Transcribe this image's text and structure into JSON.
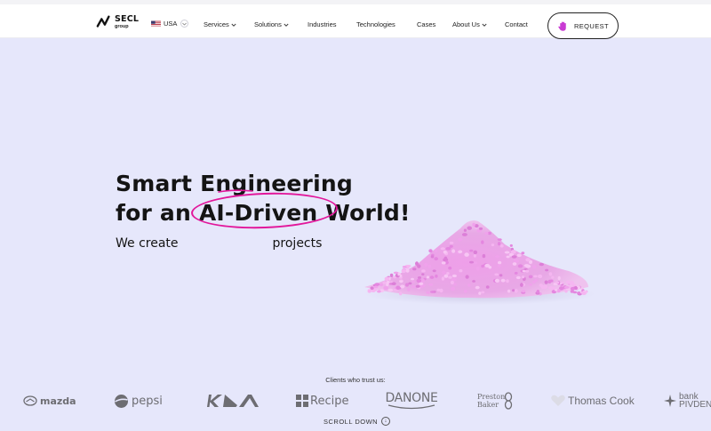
{
  "header": {
    "logo": {
      "name": "SECL",
      "sub": "group"
    },
    "language": {
      "code": "USA"
    },
    "nav": [
      {
        "label": "Services",
        "dropdown": true
      },
      {
        "label": "Solutions",
        "dropdown": true
      },
      {
        "label": "Industries",
        "dropdown": false
      },
      {
        "label": "Technologies",
        "dropdown": false
      },
      {
        "label": "Cases",
        "dropdown": false
      },
      {
        "label": "About Us",
        "dropdown": true
      },
      {
        "label": "Contact",
        "dropdown": false
      }
    ],
    "request_label": "REQUEST"
  },
  "hero": {
    "title_line1_a": "Smart ",
    "title_line1_b": "Engineering",
    "title_line2_a": "for an ",
    "title_line2_highlight": "AI-Driven",
    "title_line2_b": " World!",
    "subtitle_a": "We create",
    "subtitle_b": "projects",
    "accent_color": "#e2179b",
    "pile_color": "#e9a6e6"
  },
  "clients": {
    "label": "Clients who trust us:",
    "logos": [
      "mazda",
      "pepsi",
      "KIA",
      "Recipe",
      "DANONE",
      "Preston Baker",
      "Thomas Cook",
      "bank PIVDENNY"
    ]
  },
  "scroll_label": "SCROLL DOWN",
  "colors": {
    "background": "#e6e7fb",
    "text": "#141414",
    "muted": "#6d6d72"
  }
}
